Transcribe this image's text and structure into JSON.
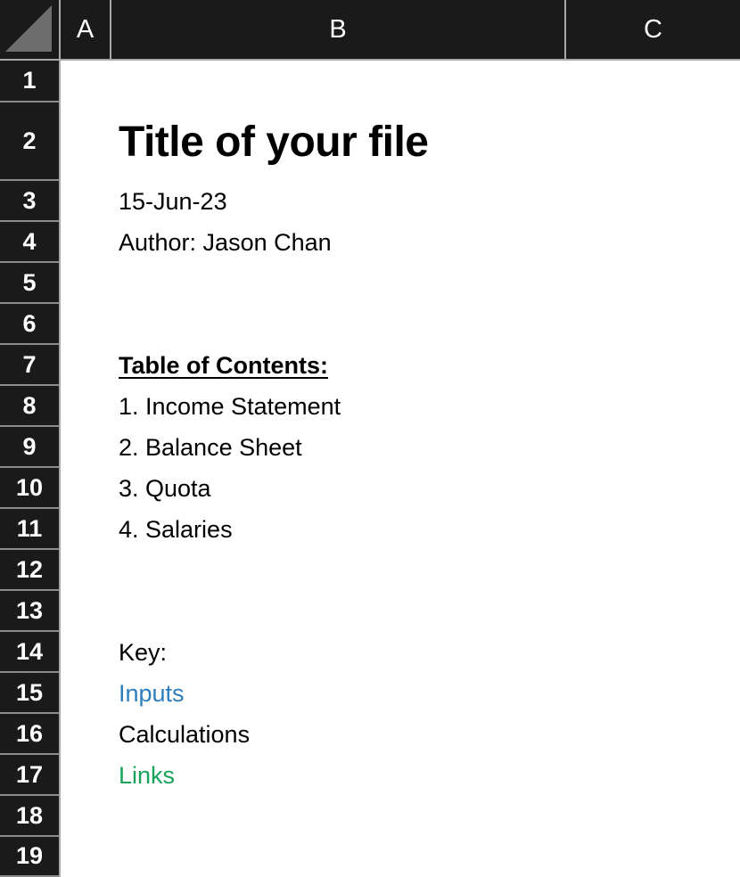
{
  "app": {
    "type": "spreadsheet",
    "select_all_corner": "select-all-triangle"
  },
  "columns": [
    {
      "id": "A",
      "label": "A"
    },
    {
      "id": "B",
      "label": "B"
    },
    {
      "id": "C",
      "label": "C"
    }
  ],
  "rows": [
    {
      "number": "1"
    },
    {
      "number": "2"
    },
    {
      "number": "3"
    },
    {
      "number": "4"
    },
    {
      "number": "5"
    },
    {
      "number": "6"
    },
    {
      "number": "7"
    },
    {
      "number": "8"
    },
    {
      "number": "9"
    },
    {
      "number": "10"
    },
    {
      "number": "11"
    },
    {
      "number": "12"
    },
    {
      "number": "13"
    },
    {
      "number": "14"
    },
    {
      "number": "15"
    },
    {
      "number": "16"
    },
    {
      "number": "17"
    },
    {
      "number": "18"
    },
    {
      "number": "19"
    }
  ],
  "cells": {
    "b2_title": "Title of your file",
    "b3_date": "15-Jun-23",
    "b4_author": "Author: Jason Chan",
    "b7_toc_heading": "Table of Contents:",
    "b8_toc_1": "1. Income Statement",
    "b9_toc_2": "2. Balance Sheet",
    "b10_toc_3": "3. Quota",
    "b11_toc_4": "4. Salaries",
    "b14_key_heading": "Key:",
    "b15_key_inputs": "Inputs",
    "b16_key_calculations": "Calculations",
    "b17_key_links": "Links"
  },
  "colors": {
    "header_background": "#1a1a1a",
    "header_text": "#ffffff",
    "grid_background": "#ffffff",
    "body_text": "#000000",
    "inputs_blue": "#2e7ebb",
    "links_green": "#17a45a",
    "corner_triangle": "#6d6d6d",
    "header_divider": "#a8a8a8"
  }
}
